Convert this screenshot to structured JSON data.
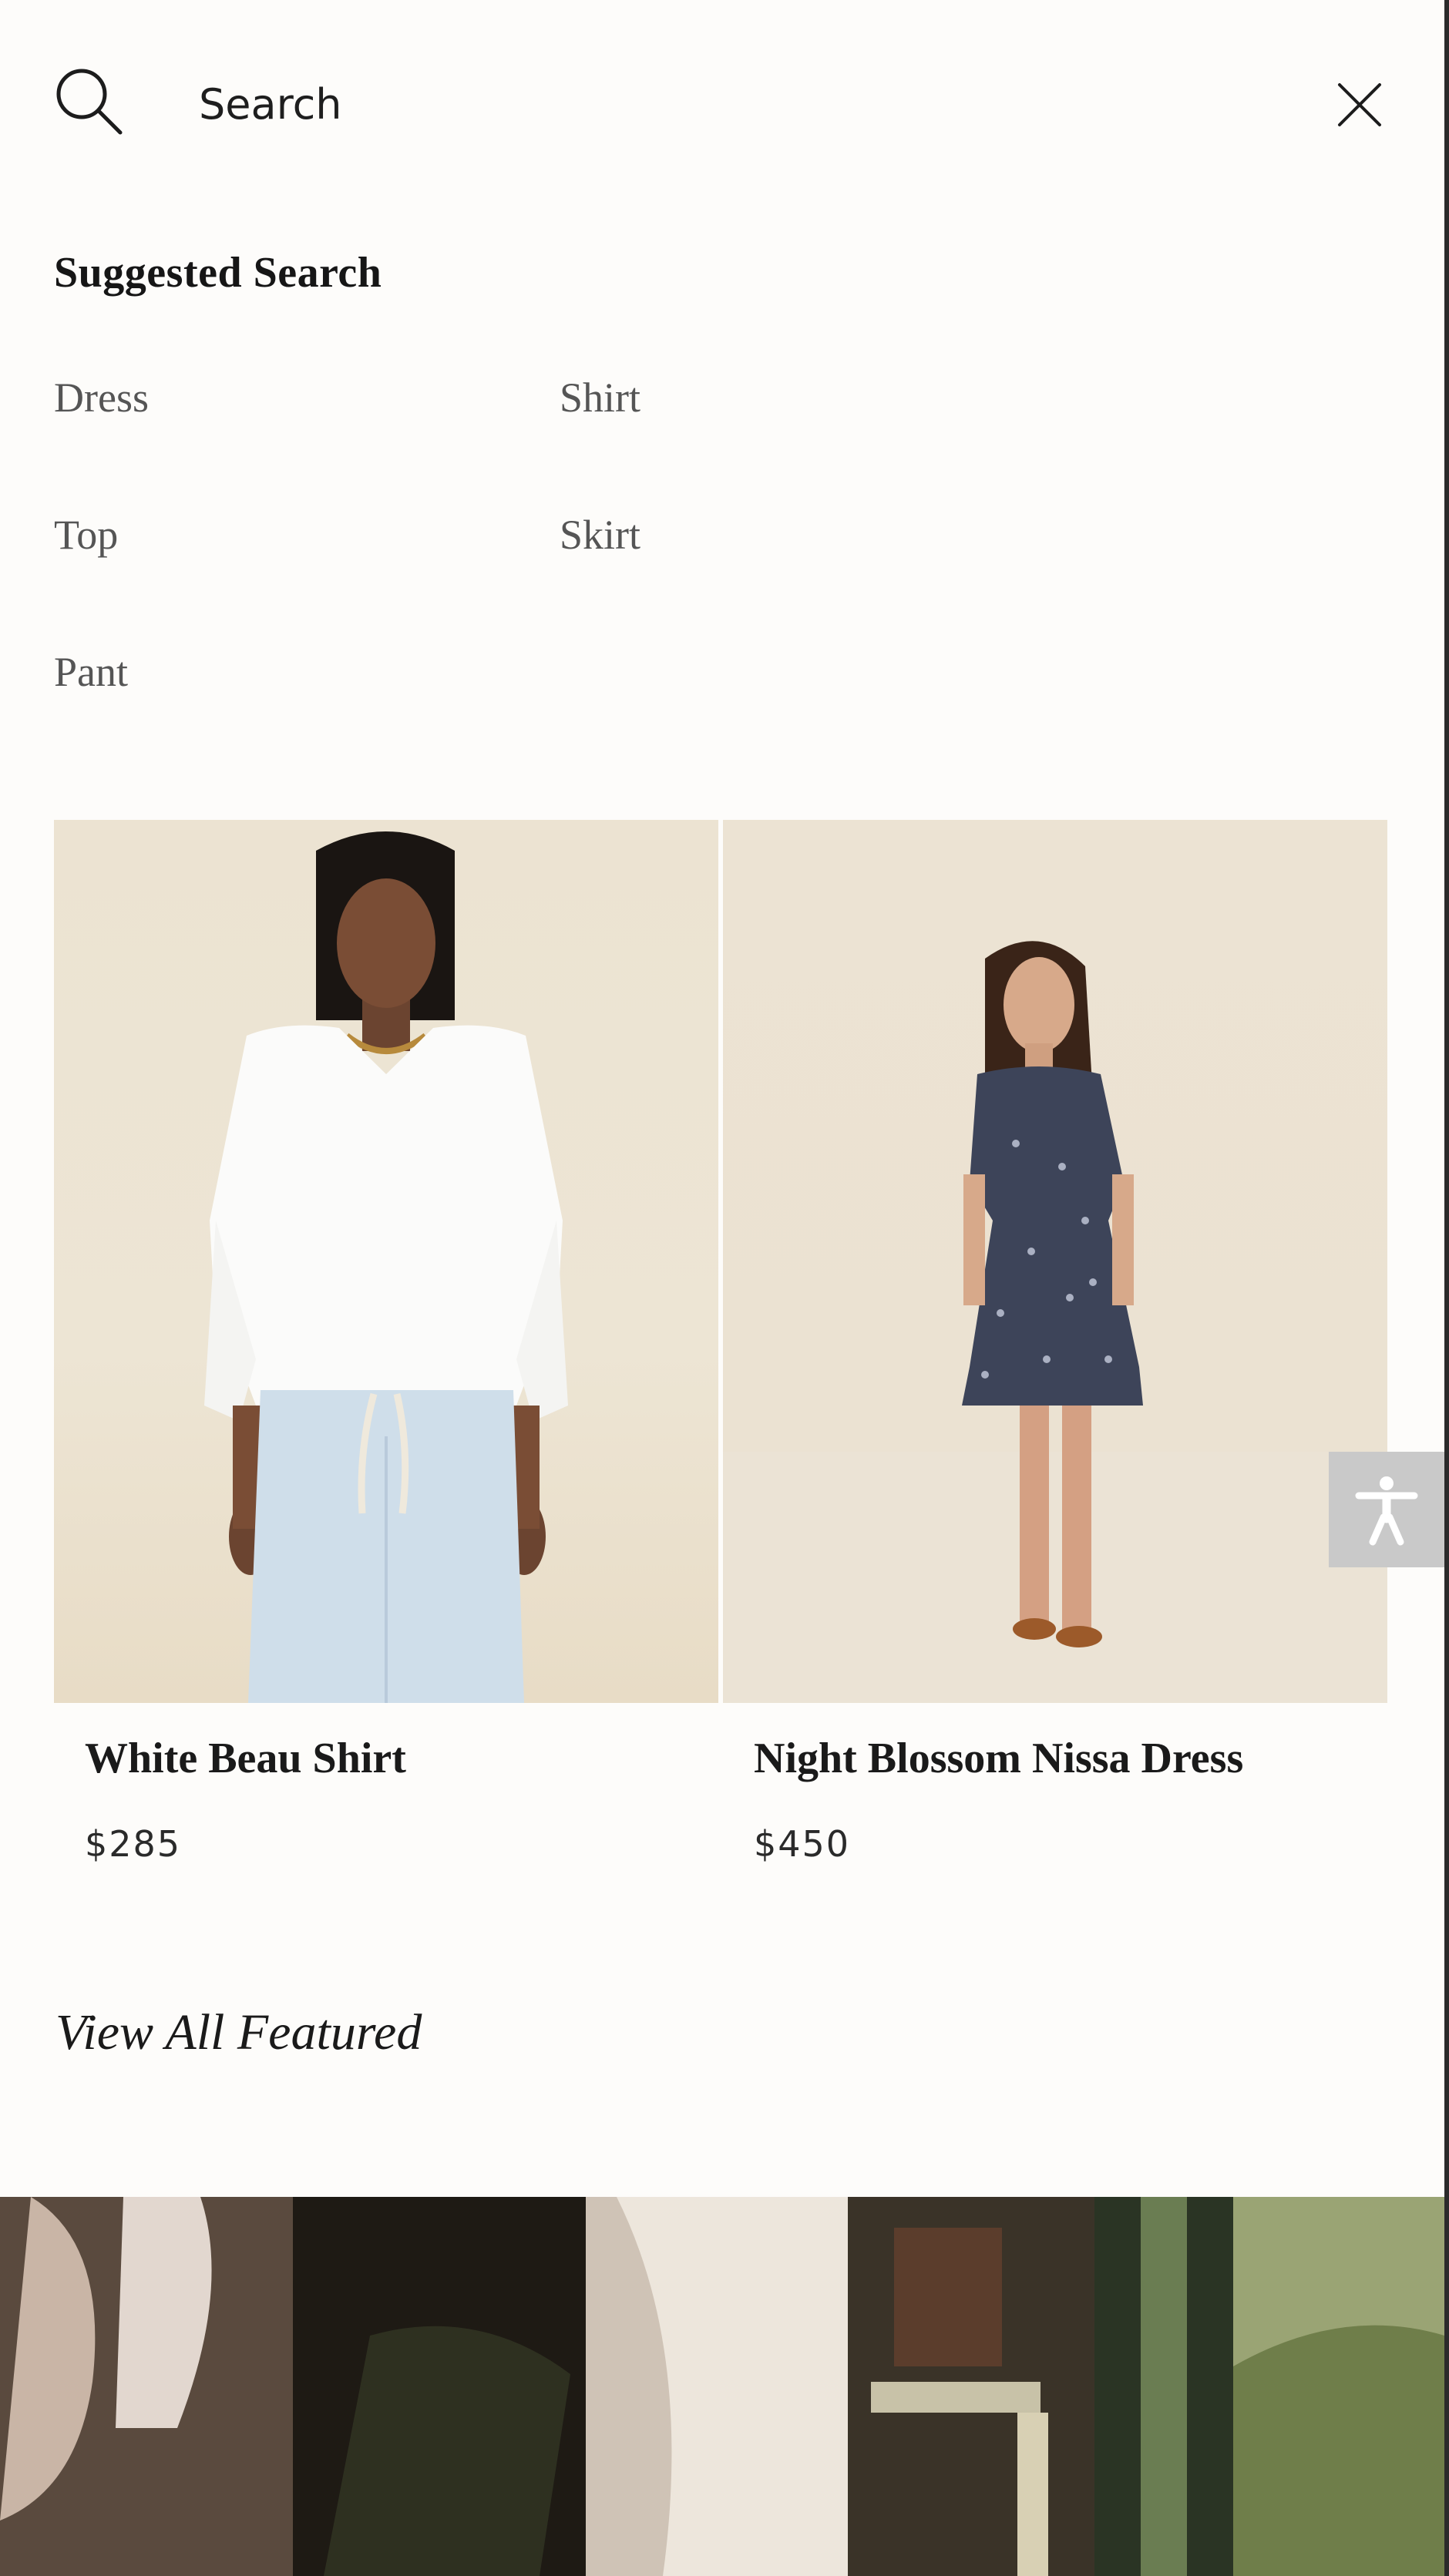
{
  "search": {
    "placeholder": "Search",
    "icon": "search-icon",
    "close_icon": "close-icon"
  },
  "suggested": {
    "title": "Suggested Search",
    "items": [
      "Dress",
      "Shirt",
      "Top",
      "Skirt",
      "Pant"
    ]
  },
  "products": [
    {
      "name": "White Beau Shirt",
      "price": "$285"
    },
    {
      "name": "Night Blossom Nissa Dress",
      "price": "$450"
    }
  ],
  "view_all": "View All Featured",
  "accessibility": {
    "icon": "accessibility-icon"
  },
  "colors": {
    "background": "#fdfcfa",
    "accessibility_bg": "#c9c9c9",
    "suggestion_text": "#555555"
  }
}
